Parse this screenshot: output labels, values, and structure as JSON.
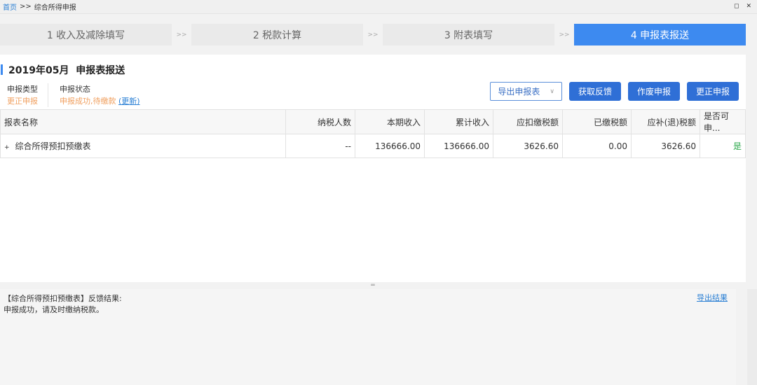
{
  "breadcrumb": {
    "home": "首页",
    "sep": ">>",
    "current": "综合所得申报"
  },
  "window_controls": [
    "restore-icon",
    "close-icon"
  ],
  "steps": [
    {
      "label": "1 收入及减除填写"
    },
    {
      "label": "2 税款计算"
    },
    {
      "label": "3 附表填写"
    },
    {
      "label": "4 申报表报送",
      "active": true
    }
  ],
  "step_sep": ">>",
  "panel": {
    "title": "2019年05月  申报表报送",
    "type_label": "申报类型",
    "type_value": "更正申报",
    "status_label": "申报状态",
    "status_value": "申报成功,待缴款",
    "refresh": "(更新)",
    "export_select": "导出申报表",
    "buttons": [
      "获取反馈",
      "作废申报",
      "更正申报"
    ]
  },
  "table": {
    "headers": [
      "报表名称",
      "纳税人数",
      "本期收入",
      "累计收入",
      "应扣缴税额",
      "已缴税额",
      "应补(退)税额",
      "是否可申..."
    ],
    "rows": [
      [
        "综合所得预扣预缴表",
        "--",
        "136666.00",
        "136666.00",
        "3626.60",
        "0.00",
        "3626.60",
        "是"
      ]
    ]
  },
  "feedback": {
    "line1": "【综合所得预扣预缴表】反馈结果:",
    "line2": "申报成功，请及时缴纳税款。",
    "export": "导出结果"
  },
  "colors": {
    "accent": "#3d8af0",
    "button": "#2f6fd6",
    "orange": "#f0a060",
    "green": "#2aa84a"
  }
}
